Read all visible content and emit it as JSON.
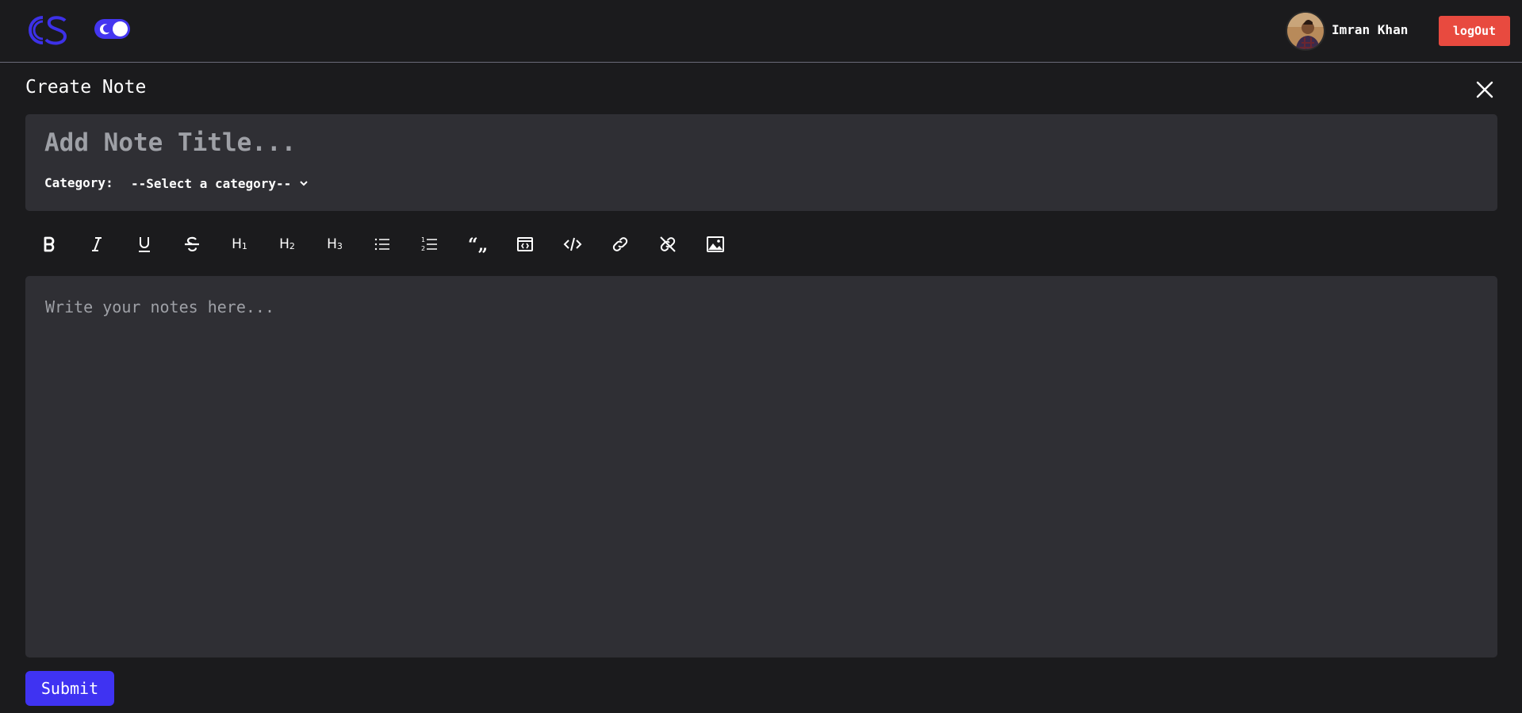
{
  "header": {
    "logo": "CS",
    "theme_toggle_icon": "moon-icon",
    "user_name": "Imran Khan",
    "logout_label": "logOut"
  },
  "page": {
    "title": "Create Note",
    "close_icon": "close-icon"
  },
  "note_form": {
    "title_placeholder": "Add Note Title...",
    "category_label": "Category:",
    "category_selected": "--Select a category--",
    "editor_placeholder": "Write your notes here...",
    "submit_label": "Submit"
  },
  "toolbar": {
    "tools": [
      {
        "name": "bold",
        "icon": "bold-icon"
      },
      {
        "name": "italic",
        "icon": "italic-icon"
      },
      {
        "name": "underline",
        "icon": "underline-icon"
      },
      {
        "name": "strikethrough",
        "icon": "strikethrough-icon"
      },
      {
        "name": "heading-1",
        "icon": "heading-1-icon",
        "text": "H",
        "sub": "1"
      },
      {
        "name": "heading-2",
        "icon": "heading-2-icon",
        "text": "H",
        "sub": "2"
      },
      {
        "name": "heading-3",
        "icon": "heading-3-icon",
        "text": "H",
        "sub": "3"
      },
      {
        "name": "bullet-list",
        "icon": "bullet-list-icon"
      },
      {
        "name": "numbered-list",
        "icon": "numbered-list-icon"
      },
      {
        "name": "blockquote",
        "icon": "quote-icon"
      },
      {
        "name": "code-block",
        "icon": "code-block-icon"
      },
      {
        "name": "inline-code",
        "icon": "code-icon"
      },
      {
        "name": "link",
        "icon": "link-icon"
      },
      {
        "name": "unlink",
        "icon": "unlink-icon"
      },
      {
        "name": "image",
        "icon": "image-icon"
      }
    ]
  },
  "colors": {
    "background": "#1b1b1d",
    "panel": "#2f2f34",
    "accent": "#3f33f2",
    "logout": "#e84a3f"
  }
}
